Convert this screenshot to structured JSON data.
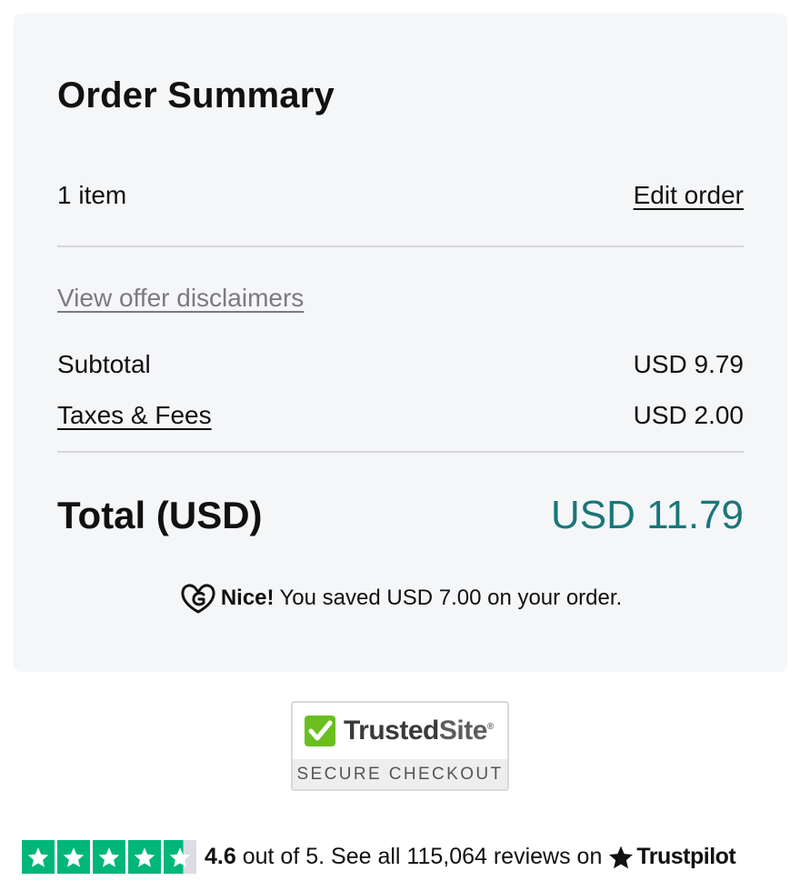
{
  "summary": {
    "title": "Order Summary",
    "item_count": "1 item",
    "edit_order_label": "Edit order",
    "disclaimers_label": "View offer disclaimers",
    "subtotal_label": "Subtotal",
    "subtotal_value": "USD 9.79",
    "taxes_label": "Taxes & Fees",
    "taxes_value": "USD 2.00",
    "total_label": "Total (USD)",
    "total_value": "USD 11.79",
    "savings_prefix": "Nice!",
    "savings_text": "You saved USD 7.00 on your order."
  },
  "trusted_site": {
    "name_part1": "Trusted",
    "name_part2": "Site",
    "trademark": "®",
    "caption": "SECURE CHECKOUT"
  },
  "trustpilot": {
    "score": "4.6",
    "score_text": " out of 5. ",
    "reviews_text": "See all 115,064 reviews on",
    "brand": "Trustpilot",
    "rating_fraction": 0.92
  },
  "colors": {
    "card_bg": "#f5f6f8",
    "total_accent": "#1a7679",
    "trustpilot_green": "#00b67a",
    "trusted_check_green": "#6abf1f"
  }
}
